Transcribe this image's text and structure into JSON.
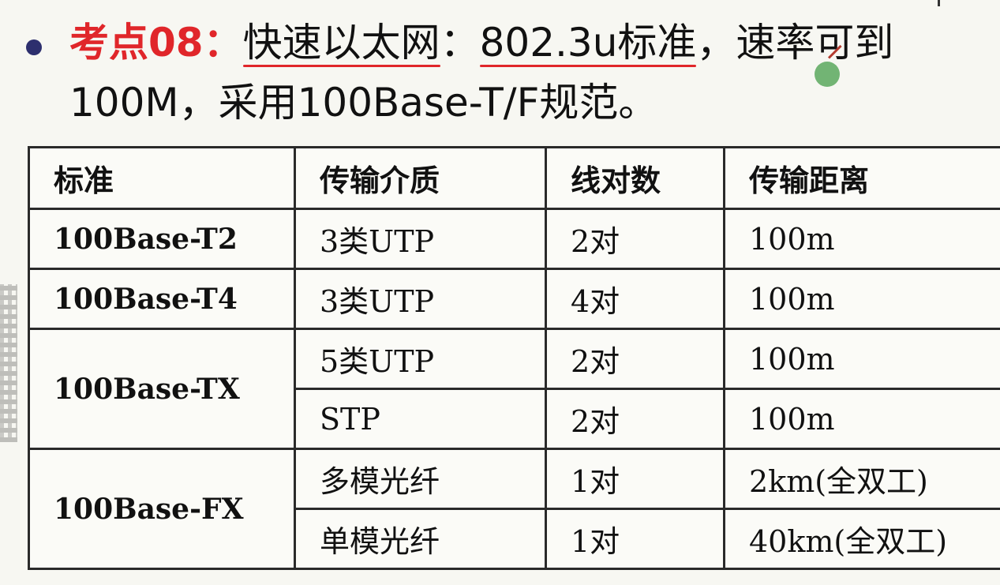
{
  "heading": {
    "label": "考点08：",
    "line1_part1": "快速以太网",
    "line1_sep": "：",
    "line1_part2": "802.3u标准",
    "line1_part3": "，速率可到",
    "line2": "100M，采用100Base-T/F规范。"
  },
  "table": {
    "headers": [
      "标准",
      "传输介质",
      "线对数",
      "传输距离"
    ],
    "groups": [
      {
        "standard": "100Base-T2",
        "rows": [
          {
            "medium": "3类UTP",
            "pairs": "2对",
            "distance": "100m"
          }
        ]
      },
      {
        "standard": "100Base-T4",
        "rows": [
          {
            "medium": "3类UTP",
            "pairs": "4对",
            "distance": "100m"
          }
        ]
      },
      {
        "standard": "100Base-TX",
        "rows": [
          {
            "medium": "5类UTP",
            "pairs": "2对",
            "distance": "100m"
          },
          {
            "medium": "STP",
            "pairs": "2对",
            "distance": "100m"
          }
        ]
      },
      {
        "standard": "100Base-FX",
        "rows": [
          {
            "medium": "多模光纤",
            "pairs": "1对",
            "distance": "2km(全双工)"
          },
          {
            "medium": "单模光纤",
            "pairs": "1对",
            "distance": "40km(全双工)"
          }
        ]
      }
    ]
  },
  "colors": {
    "accent": "#e0262a",
    "bullet": "#2d2f6e",
    "border": "#2a2a2a"
  }
}
